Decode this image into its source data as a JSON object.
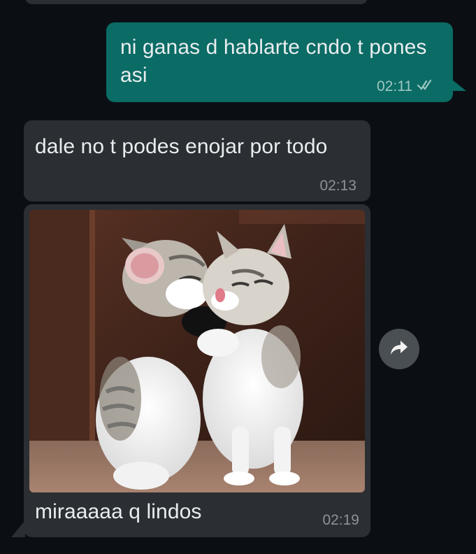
{
  "messages": [
    {
      "direction": "outgoing",
      "text": "ni ganas d hablarte cndo t pones asi",
      "time": "02:11",
      "status": "read"
    },
    {
      "direction": "incoming",
      "text": "dale no t podes enojar por todo",
      "time": "02:13"
    },
    {
      "direction": "incoming",
      "type": "image",
      "image": "kittens",
      "caption": "miraaaaa q lindos",
      "time": "02:19"
    }
  ],
  "icons": {
    "read_receipt": "double-check-icon",
    "forward": "forward-arrow-icon"
  },
  "colors": {
    "background": "#0b0f14",
    "outgoing_bubble": "#0b6b65",
    "incoming_bubble": "#2b2f33",
    "text": "#e9edef"
  }
}
